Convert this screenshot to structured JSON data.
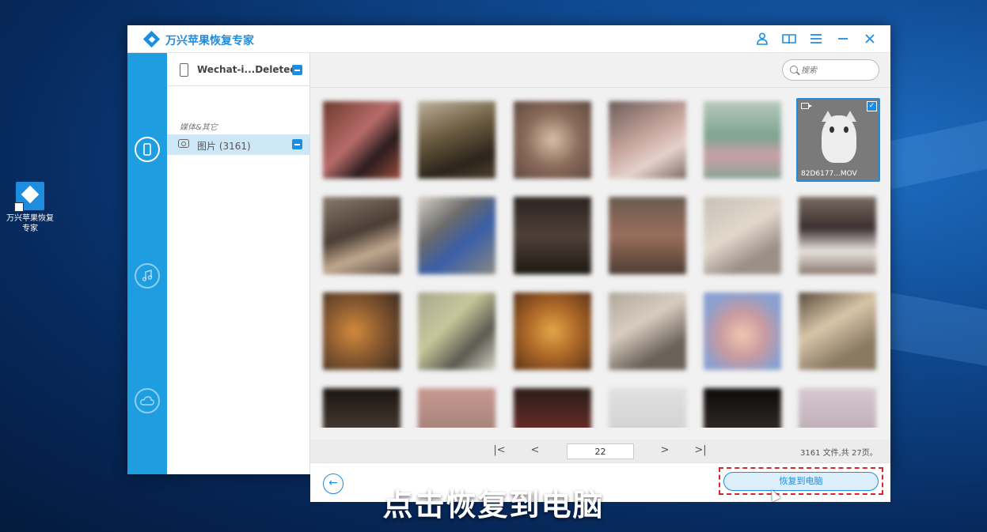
{
  "desktop": {
    "icon_label": "万兴苹果恢复专家"
  },
  "window": {
    "app_title": "万兴苹果恢复专家",
    "titlebar_icons": [
      "user-icon",
      "book-icon",
      "menu-icon",
      "minimize-icon",
      "close-icon"
    ]
  },
  "rail": {
    "items": [
      "device-recover-icon",
      "itunes-recover-icon",
      "icloud-recover-icon"
    ],
    "active": 0
  },
  "tree": {
    "device_name": "Wechat-i...Deleted",
    "category_label": "媒体&其它",
    "item_label": "图片 (3161)"
  },
  "search": {
    "placeholder": "搜索"
  },
  "grid": {
    "selected_file": "82D6177...MOV"
  },
  "pager": {
    "first": "|<",
    "prev": "<",
    "page": "22",
    "next": ">",
    "last": ">|",
    "info": "3161 文件,共 27页。"
  },
  "footer": {
    "back_label": "←",
    "recover_label": "恢复到电脑"
  },
  "subtitle": "点击恢复到电脑",
  "colors": {
    "accent": "#1e8de0",
    "rail": "#1e9de0",
    "highlight_dash": "#d9262c"
  }
}
